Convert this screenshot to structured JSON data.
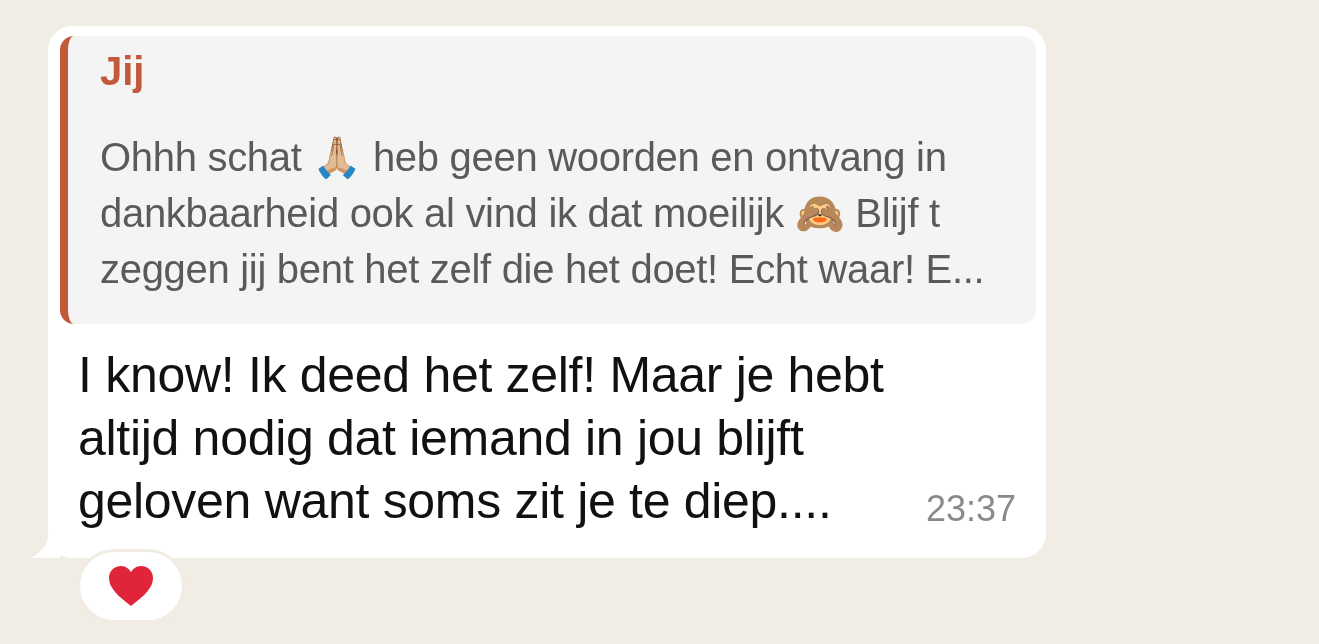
{
  "message": {
    "quote": {
      "author": "Jij",
      "lines": [
        "Ohhh schat 🙏🏼 heb geen woorden en ontvang in",
        "dankbaarheid ook al vind ik dat moeilijk 🙈 Blijf t",
        "zeggen jij bent het zelf die het doet! Echt waar! E..."
      ]
    },
    "lines": [
      "I know! Ik deed het zelf! Maar je hebt",
      "altijd nodig dat iemand in jou blijft",
      "geloven want soms zit je te diep...."
    ],
    "time": "23:37",
    "reactions": [
      {
        "kind": "heart"
      }
    ]
  }
}
